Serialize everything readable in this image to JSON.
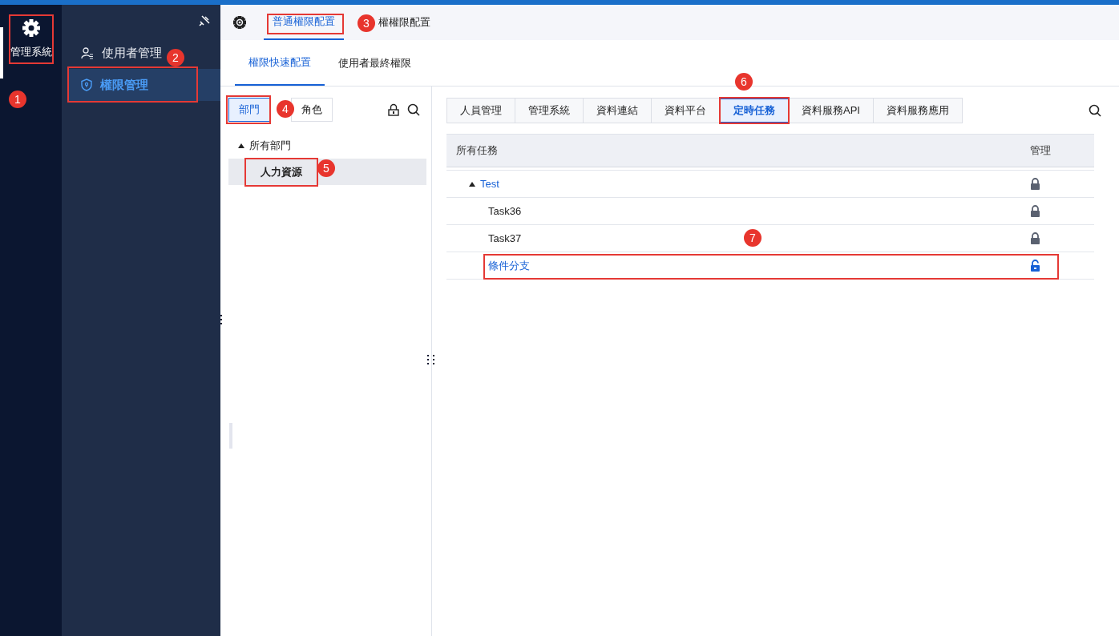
{
  "app_rail": {
    "label": "管理系統",
    "selected": true,
    "boxed": true,
    "callout": "1"
  },
  "sidebar": {
    "items": [
      {
        "label": "使用者管理",
        "selected": false,
        "boxed": false,
        "callout": "2"
      },
      {
        "label": "權限管理",
        "selected": true,
        "boxed": true
      }
    ]
  },
  "top_tabs": [
    {
      "label": "普通權限配置",
      "selected": true,
      "boxed": true,
      "callout": "3"
    },
    {
      "label": "權權限配置",
      "selected": false,
      "boxed": false
    }
  ],
  "sub_tabs": [
    {
      "label": "權限快速配置",
      "selected": true
    },
    {
      "label": "使用者最終權限",
      "selected": false
    }
  ],
  "left_panel": {
    "segments": [
      {
        "label": "部門",
        "selected": true,
        "boxed": true,
        "callout": "4"
      },
      {
        "label": "角色",
        "selected": false,
        "boxed": false
      }
    ],
    "tree": [
      {
        "label": "所有部門",
        "expanded": true,
        "selected": false,
        "boxed": false,
        "children": [
          {
            "label": "人力資源",
            "selected": true,
            "boxed": true,
            "callout": "5"
          }
        ]
      }
    ]
  },
  "right_panel": {
    "tabs": [
      {
        "label": "人員管理",
        "selected": false,
        "boxed": false
      },
      {
        "label": "管理系統",
        "selected": false,
        "boxed": false
      },
      {
        "label": "資料連結",
        "selected": false,
        "boxed": false
      },
      {
        "label": "資料平台",
        "selected": false,
        "boxed": false
      },
      {
        "label": "定時任務",
        "selected": true,
        "boxed": true,
        "callout": "6"
      },
      {
        "label": "資料服務API",
        "selected": false,
        "boxed": false
      },
      {
        "label": "資料服務應用",
        "selected": false,
        "boxed": false
      }
    ],
    "table": {
      "columns": [
        "所有任務",
        "管理"
      ],
      "rows": [
        {
          "name": "Test",
          "kind": "folder",
          "expanded": true,
          "locked": true,
          "boxed": false,
          "children": [
            {
              "name": "Task36",
              "kind": "task",
              "locked": true,
              "boxed": false
            },
            {
              "name": "Task37",
              "kind": "task",
              "locked": true,
              "boxed": false
            },
            {
              "name": "條件分支",
              "kind": "task",
              "locked": false,
              "boxed": true,
              "callout": "7"
            }
          ]
        }
      ]
    }
  }
}
